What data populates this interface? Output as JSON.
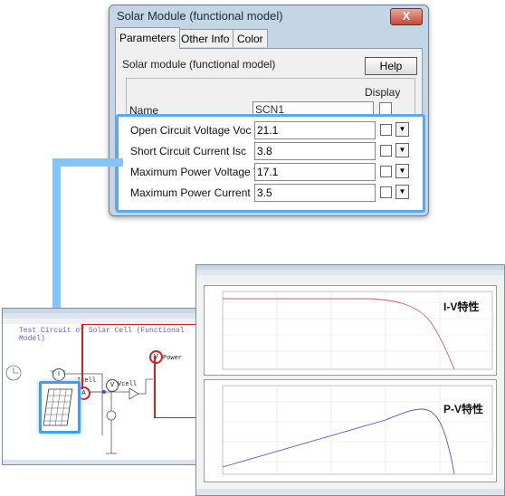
{
  "dialog": {
    "title": "Solar Module (functional model)",
    "close_glyph": "X",
    "tabs": [
      "Parameters",
      "Other Info",
      "Color"
    ],
    "subtitle": "Solar module (functional model)",
    "help_label": "Help",
    "display_label": "Display",
    "name_label": "Name",
    "name_value": "SCN1",
    "params": [
      {
        "label": "Open Circuit Voltage Voc",
        "value": "21.1"
      },
      {
        "label": "Short Circuit Current Isc",
        "value": "3.8"
      },
      {
        "label": "Maximum Power Voltage Vm",
        "value": "17.1"
      },
      {
        "label": "Maximum Power Current Im",
        "value": "3.5"
      }
    ]
  },
  "circuit": {
    "title": "Test Circuit of Solar Cell (Functional Model)",
    "icell": "Icell",
    "vcell": "Vcell",
    "power": "Power",
    "ammeter": "A",
    "voltmeter": "V",
    "power_meter": "V"
  },
  "graph": {
    "iv_label": "I-V特性",
    "pv_label": "P-V特性"
  },
  "colors": {
    "highlight": "#5aa8ef",
    "accent_red": "#d02020",
    "iv_curve": "#d05a6a",
    "pv_curve": "#5a55c0"
  }
}
